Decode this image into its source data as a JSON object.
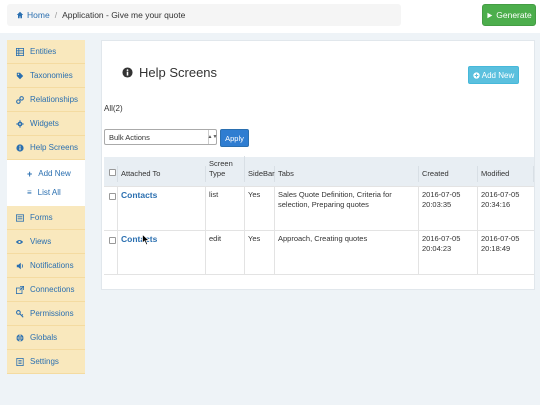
{
  "breadcrumb": {
    "home": "Home",
    "current": "Application - Give me your quote"
  },
  "toolbar": {
    "generate": "Generate"
  },
  "sidebar": {
    "items": [
      {
        "label": "Entities",
        "icon": "table-icon"
      },
      {
        "label": "Taxonomies",
        "icon": "tag-icon"
      },
      {
        "label": "Relationships",
        "icon": "link-icon"
      },
      {
        "label": "Widgets",
        "icon": "gear-icon"
      },
      {
        "label": "Help Screens",
        "icon": "info-icon"
      }
    ],
    "sub": [
      {
        "label": "Add New",
        "icon": "plus-icon"
      },
      {
        "label": "List All",
        "icon": "list-icon"
      }
    ],
    "items2": [
      {
        "label": "Forms",
        "icon": "form-icon"
      },
      {
        "label": "Views",
        "icon": "eye-icon"
      },
      {
        "label": "Notifications",
        "icon": "volume-icon"
      },
      {
        "label": "Connections",
        "icon": "external-link-icon"
      },
      {
        "label": "Permissions",
        "icon": "key-icon"
      },
      {
        "label": "Globals",
        "icon": "globe-icon"
      },
      {
        "label": "Settings",
        "icon": "settings-icon"
      }
    ]
  },
  "main": {
    "title": "Help Screens",
    "add_new": "Add New",
    "filter_all": "All(2)",
    "bulk_actions": "Bulk Actions",
    "apply": "Apply",
    "columns": {
      "attached": "Attached To",
      "screen_type": "Screen Type",
      "sidebar": "SideBar",
      "tabs": "Tabs",
      "created": "Created",
      "modified": "Modified"
    },
    "rows": [
      {
        "attached": "Contacts",
        "type": "list",
        "sidebar": "Yes",
        "tabs": "Sales Quote Definition, Criteria for selection, Preparing quotes",
        "created": "2016-07-05 20:03:35",
        "modified": "2016-07-05 20:34:16"
      },
      {
        "attached": "Contacts",
        "type": "edit",
        "sidebar": "Yes",
        "tabs": "Approach, Creating quotes",
        "created": "2016-07-05 20:04:23",
        "modified": "2016-07-05 20:18:49"
      }
    ]
  },
  "colors": {
    "accent": "#2a6fb0",
    "sidebar_bg": "#f9e8bd",
    "generate": "#4cae4c",
    "add_new": "#5bc0de",
    "apply": "#2f7dd1"
  }
}
